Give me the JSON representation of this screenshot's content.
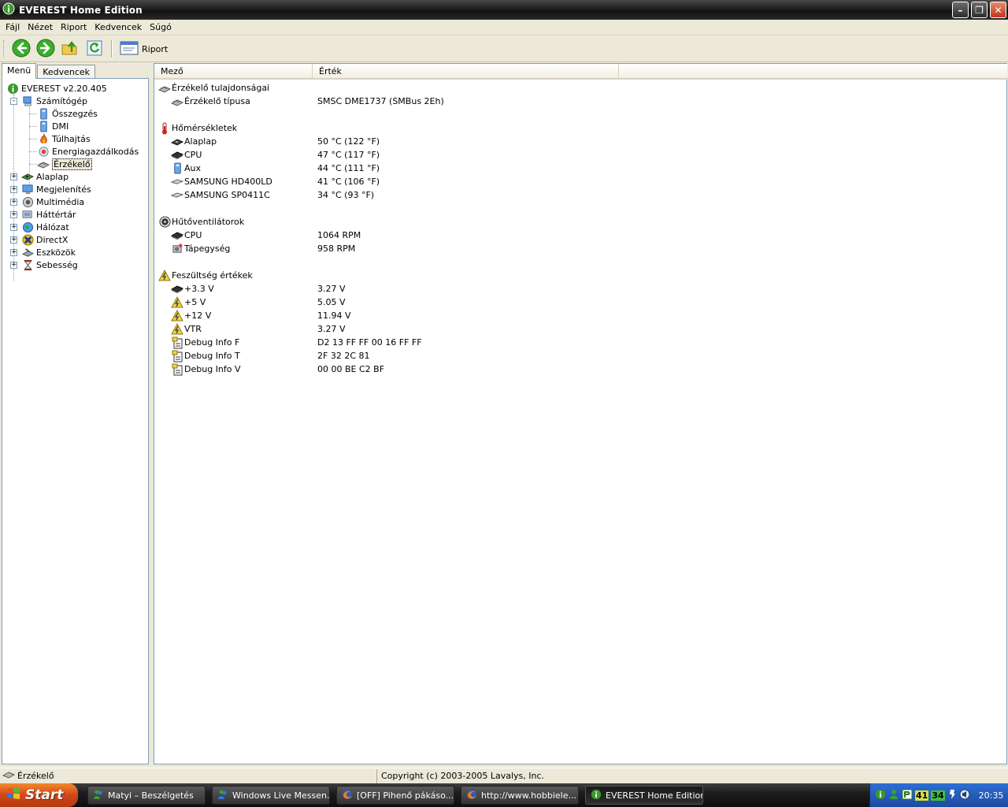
{
  "window": {
    "title": "EVEREST Home Edition",
    "minimize_label": "–",
    "maximize_label": "❐",
    "close_label": "✕"
  },
  "menubar": {
    "items": [
      "Fájl",
      "Nézet",
      "Riport",
      "Kedvencek",
      "Súgó"
    ]
  },
  "toolbar": {
    "buttons": [
      "back-icon",
      "forward-icon",
      "up-icon",
      "refresh-icon"
    ],
    "report_label": "Riport"
  },
  "left_tabs": [
    "Menü",
    "Kedvencek"
  ],
  "tree": {
    "root": "EVEREST v2.20.405",
    "computer": "Számítógép",
    "computer_children": [
      "Összegzés",
      "DMI",
      "Túlhajtás",
      "Energiagazdálkodás",
      "Érzékelő"
    ],
    "top_items": [
      "Alaplap",
      "Megjelenítés",
      "Multimédia",
      "Háttértár",
      "Hálózat",
      "DirectX",
      "Eszközök",
      "Sebesség"
    ],
    "expander_plus": "+",
    "expander_minus": "-"
  },
  "columns": {
    "field": "Mező",
    "value": "Érték"
  },
  "sections": [
    {
      "title": "Érzékelő tulajdonságai",
      "icon": "sensor-icon",
      "rows": [
        {
          "label": "Érzékelő típusa",
          "value": "SMSC DME1737  (SMBus 2Eh)",
          "icon": "sensor-icon"
        }
      ]
    },
    {
      "title": "Hőmérsékletek",
      "icon": "thermometer-icon",
      "rows": [
        {
          "label": "Alaplap",
          "value": "50 °C  (122 °F)",
          "icon": "motherboard-icon"
        },
        {
          "label": "CPU",
          "value": "47 °C  (117 °F)",
          "icon": "cpu-icon"
        },
        {
          "label": "Aux",
          "value": "44 °C  (111 °F)",
          "icon": "computer-icon"
        },
        {
          "label": "SAMSUNG HD400LD",
          "value": "41 °C  (106 °F)",
          "icon": "harddisk-icon"
        },
        {
          "label": "SAMSUNG SP0411C",
          "value": "34 °C  (93 °F)",
          "icon": "harddisk-icon"
        }
      ]
    },
    {
      "title": "Hűtőventilátorok",
      "icon": "fan-icon",
      "rows": [
        {
          "label": "CPU",
          "value": "1064 RPM",
          "icon": "cpu-icon"
        },
        {
          "label": "Tápegység",
          "value": "958 RPM",
          "icon": "power-supply-icon"
        }
      ]
    },
    {
      "title": "Feszültség értékek",
      "icon": "voltage-icon",
      "rows": [
        {
          "label": "+3.3 V",
          "value": "3.27 V",
          "icon": "cpu-icon"
        },
        {
          "label": "+5 V",
          "value": "5.05 V",
          "icon": "voltage-icon"
        },
        {
          "label": "+12 V",
          "value": "11.94 V",
          "icon": "voltage-icon"
        },
        {
          "label": "VTR",
          "value": "3.27 V",
          "icon": "voltage-icon"
        },
        {
          "label": "Debug Info F",
          "value": "D2 13 FF FF 00 16 FF FF",
          "icon": "debug-icon"
        },
        {
          "label": "Debug Info T",
          "value": "2F 32 2C 81",
          "icon": "debug-icon"
        },
        {
          "label": "Debug Info V",
          "value": "00 00 BE C2 BF",
          "icon": "debug-icon"
        }
      ]
    }
  ],
  "statusbar": {
    "current": "Érzékelő",
    "copyright": "Copyright (c) 2003-2005 Lavalys, Inc."
  },
  "taskbar": {
    "start_label": "Start",
    "tasks": [
      {
        "label": "Matyi – Beszélgetés",
        "icon": "messenger-icon",
        "active": false
      },
      {
        "label": "Windows Live Messen...",
        "icon": "messenger-icon",
        "active": false
      },
      {
        "label": "[OFF] Pihenő pákáso...",
        "icon": "firefox-icon",
        "active": false
      },
      {
        "label": "http://www.hobbiele...",
        "icon": "firefox-icon",
        "active": false
      },
      {
        "label": "EVEREST Home Edition",
        "icon": "everest-icon",
        "active": true
      }
    ],
    "tray_temp1": "41",
    "tray_temp2": "34",
    "clock": "20:35"
  },
  "colors": {
    "accent": "#2e6fd4",
    "start": "#d2461a",
    "selection": "#ece9d8"
  }
}
